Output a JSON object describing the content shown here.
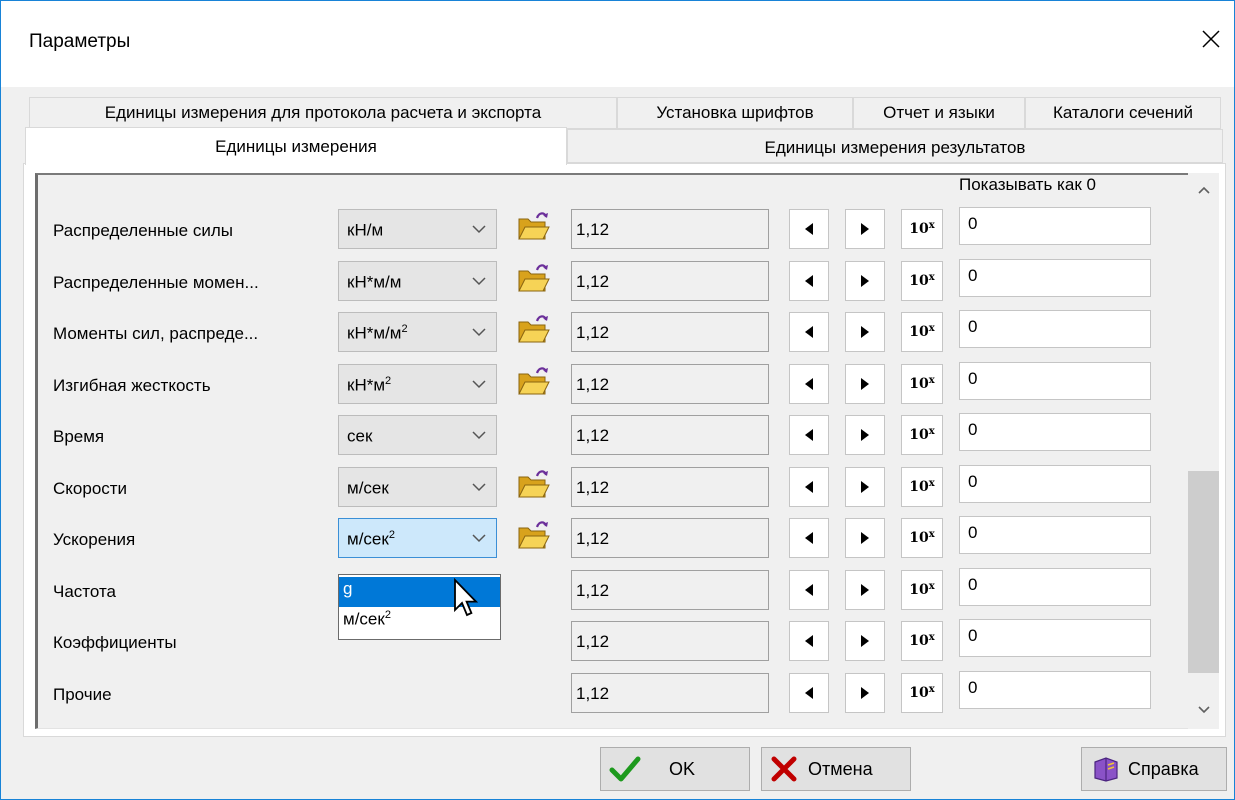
{
  "window": {
    "title": "Параметры"
  },
  "tabs": {
    "row1": [
      "Единицы измерения для протокола расчета и экспорта",
      "Установка шрифтов",
      "Отчет и языки",
      "Каталоги сечений"
    ],
    "row2": [
      "Единицы измерения",
      "Единицы измерения результатов"
    ],
    "active": "Единицы измерения"
  },
  "table": {
    "show_as_zero_header": "Показывать как 0",
    "rows": [
      {
        "label": "Распределенные силы",
        "unit": "кН/м",
        "unit_sup": "",
        "value": "1,12",
        "zero": "0"
      },
      {
        "label": "Распределенные момен...",
        "unit": "кН*м/м",
        "unit_sup": "",
        "value": "1,12",
        "zero": "0"
      },
      {
        "label": "Моменты сил, распреде...",
        "unit": "кН*м/м",
        "unit_sup": "2",
        "value": "1,12",
        "zero": "0"
      },
      {
        "label": "Изгибная жесткость",
        "unit": "кН*м",
        "unit_sup": "2",
        "value": "1,12",
        "zero": "0"
      },
      {
        "label": "Время",
        "unit": "сек",
        "unit_sup": "",
        "value": "1,12",
        "zero": "0"
      },
      {
        "label": "Скорости",
        "unit": "м/сек",
        "unit_sup": "",
        "value": "1,12",
        "zero": "0"
      },
      {
        "label": "Ускорения",
        "unit": "м/сек",
        "unit_sup": "2",
        "value": "1,12",
        "zero": "0"
      },
      {
        "label": "Частота",
        "unit": "",
        "unit_sup": "",
        "value": "1,12",
        "zero": "0"
      },
      {
        "label": "Коэффициенты",
        "unit": "",
        "unit_sup": "",
        "value": "1,12",
        "zero": "0"
      },
      {
        "label": "Прочие",
        "unit": "",
        "unit_sup": "",
        "value": "1,12",
        "zero": "0"
      }
    ],
    "exp_button": {
      "base": "10",
      "sup": "x"
    }
  },
  "dropdown": {
    "open_for": "Ускорения",
    "options": [
      {
        "text": "g",
        "sup": "",
        "selected": true
      },
      {
        "text": "м/сек",
        "sup": "2",
        "selected": false
      }
    ]
  },
  "buttons": {
    "ok": "OK",
    "cancel": "Отмена",
    "help": "Справка"
  },
  "colors": {
    "accent": "#0078d7",
    "ok_check": "#1e9a1e",
    "cancel_x": "#c00000",
    "folder": "#f2c630",
    "help_book": "#7a3fb5"
  }
}
